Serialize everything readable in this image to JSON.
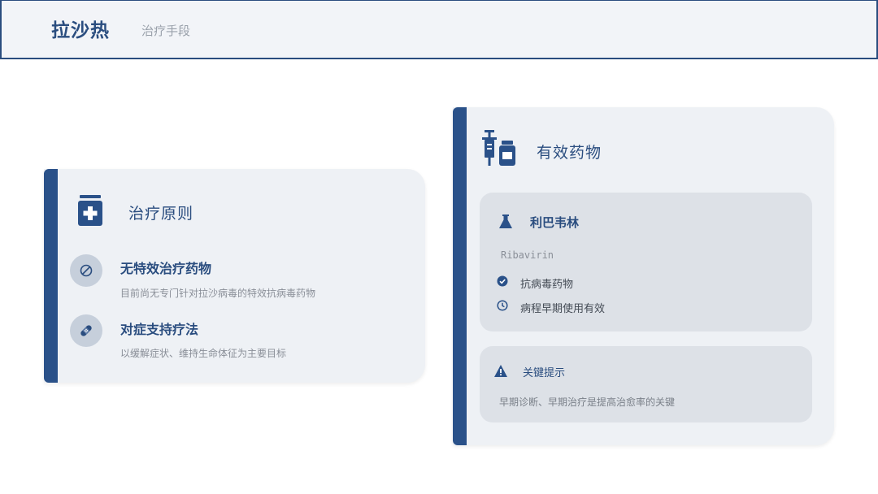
{
  "header": {
    "title": "拉沙热",
    "subtitle": "治疗手段"
  },
  "principles_card": {
    "title": "治疗原则",
    "icon": "medicine-jar-icon",
    "items": [
      {
        "icon": "ban-icon",
        "title": "无特效治疗药物",
        "description": "目前尚无专门针对拉沙病毒的特效抗病毒药物"
      },
      {
        "icon": "bandage-icon",
        "title": "对症支持疗法",
        "description": "以缓解症状、维持生命体征为主要目标"
      }
    ]
  },
  "drugs_card": {
    "title": "有效药物",
    "icon": "syringe-vial-icon",
    "drug": {
      "icon": "flask-icon",
      "name": "利巴韦林",
      "latin_name": "Ribavirin",
      "features": [
        {
          "icon": "check-circle-icon",
          "text": "抗病毒药物"
        },
        {
          "icon": "clock-icon",
          "text": "病程早期使用有效"
        }
      ]
    },
    "tip": {
      "icon": "warning-icon",
      "title": "关键提示",
      "text": "早期诊断、早期治疗是提高治愈率的关键"
    }
  },
  "colors": {
    "primary": "#2a4d7f",
    "accent_bar": "#2a5189",
    "card_bg": "#eef1f5",
    "inner_bg": "#dde1e7"
  }
}
